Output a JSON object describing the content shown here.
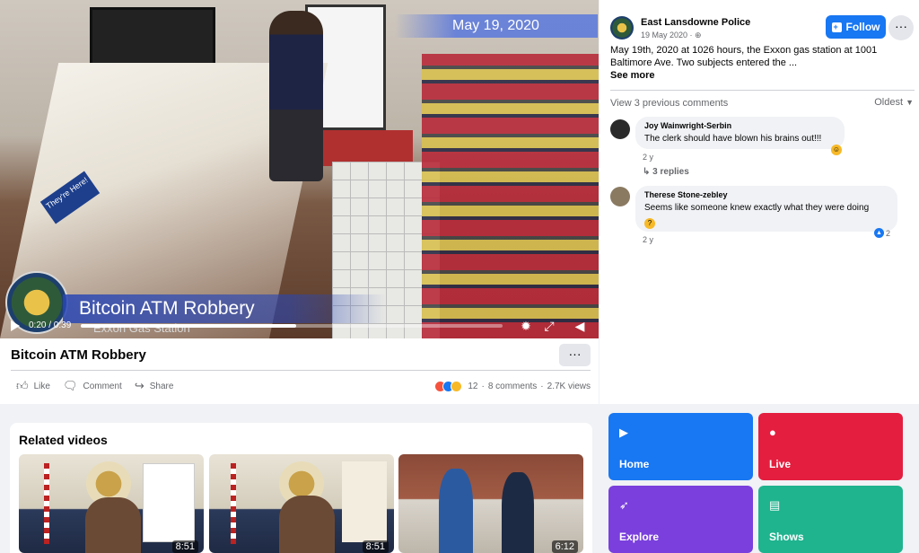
{
  "video": {
    "date_overlay": "May 19, 2020",
    "lower_third_title": "Bitcoin ATM Robbery",
    "lower_third_sub": "Exxon Gas Station",
    "time": "0:20 / 0:39",
    "progress_fraction": 0.51,
    "counter_sign": "They're Here!"
  },
  "title": "Bitcoin ATM Robbery",
  "more_label": "···",
  "actions": {
    "like": "Like",
    "comment": "Comment",
    "share": "Share"
  },
  "stats": {
    "reactions": "12",
    "comments": "8 comments",
    "views": "2.7K views",
    "separator": "·"
  },
  "post": {
    "page_name": "East Lansdowne Police",
    "date": "19 May 2020 · ",
    "follow_label": "Follow",
    "more_label": "···",
    "text": "May 19th, 2020 at 1026 hours, the Exxon gas station at 1001 Baltimore Ave. Two subjects entered the ...",
    "see_more": "See more"
  },
  "comments_header": {
    "view_previous": "View 3 previous comments",
    "sort": "Oldest"
  },
  "comments": [
    {
      "name": "Joy Wainwright-Serbin",
      "text": "The clerk should have blown his brains out!!!",
      "time": "2 y",
      "replies": "3 replies"
    },
    {
      "name": "Therese Stone-zebley",
      "text": "Seems like someone knew exactly what they were doing",
      "time": "2 y",
      "likes": "2"
    }
  ],
  "related": {
    "title": "Related videos",
    "videos": [
      {
        "duration": "8:51"
      },
      {
        "duration": "8:51"
      },
      {
        "duration": "6:12"
      }
    ]
  },
  "tiles": [
    {
      "label": "Home",
      "color": "#1877f2",
      "icon": "play-icon"
    },
    {
      "label": "Live",
      "color": "#e41e3f",
      "icon": "live-icon"
    },
    {
      "label": "Explore",
      "color": "#7a3fdd",
      "icon": "rocket-icon"
    },
    {
      "label": "Shows",
      "color": "#1fb38e",
      "icon": "shows-icon"
    }
  ],
  "colors": {
    "facebook_blue": "#1877f2",
    "text_secondary": "#65676b"
  }
}
